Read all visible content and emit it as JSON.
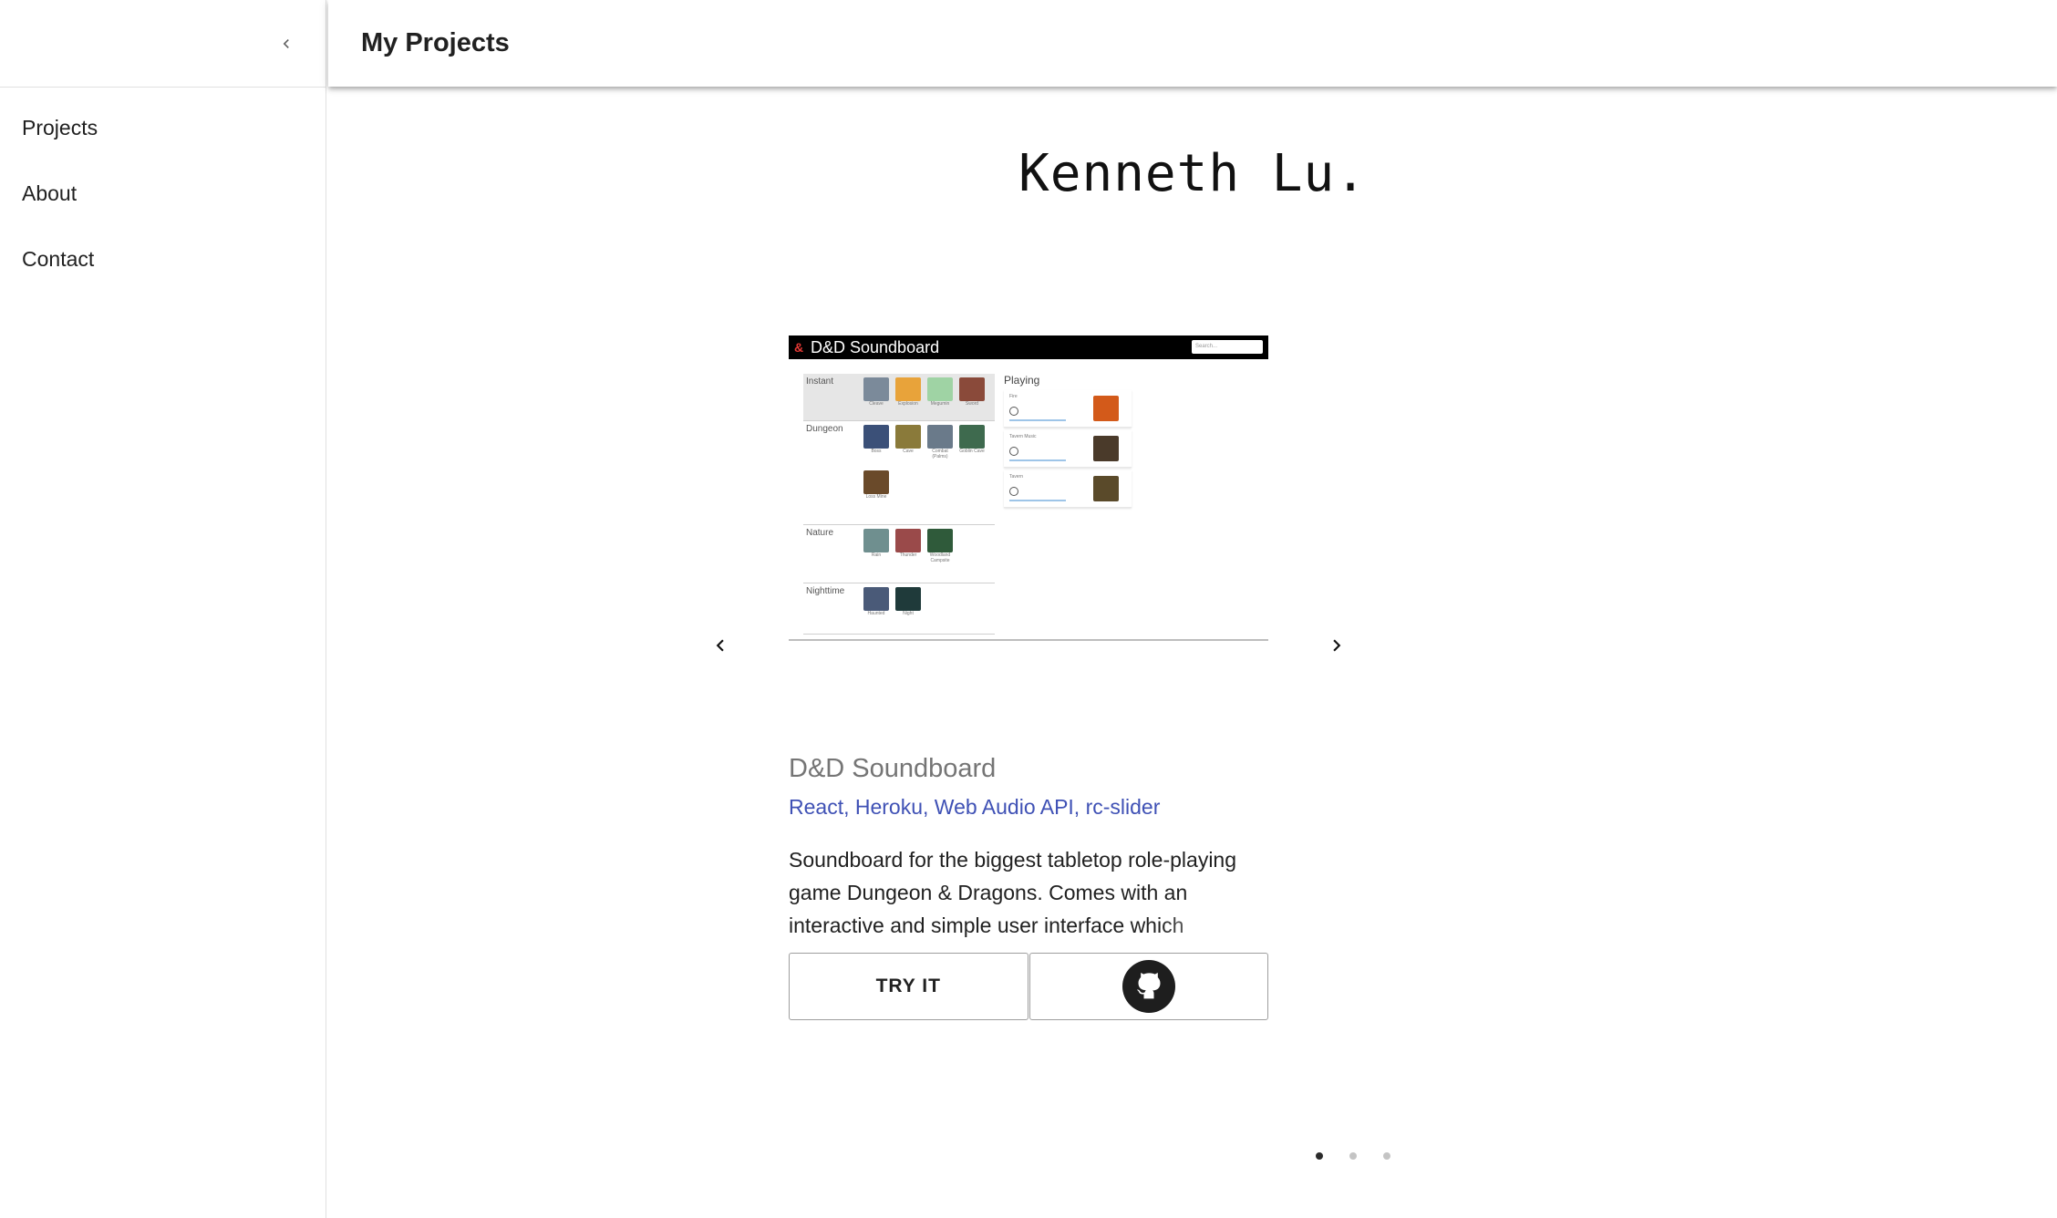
{
  "sidebar": {
    "items": [
      {
        "label": "Projects"
      },
      {
        "label": "About"
      },
      {
        "label": "Contact"
      }
    ]
  },
  "appbar": {
    "title": "My Projects"
  },
  "hero": {
    "name": "Kenneth Lu."
  },
  "carousel": {
    "current_index": 0,
    "dot_count": 3
  },
  "project": {
    "screenshot": {
      "title": "D&D Soundboard",
      "search_placeholder": "Search...",
      "sections": [
        {
          "label": "Instant",
          "tiles": [
            "Cleave",
            "Explosion",
            "Megumin",
            "Sword"
          ]
        },
        {
          "label": "Dungeon",
          "tiles": [
            "Boss",
            "Cave",
            "Combat (Palms)",
            "Goblin Cave",
            "Loss Mine"
          ]
        },
        {
          "label": "Nature",
          "tiles": [
            "Rain",
            "Thunder",
            "Woodland Campsite"
          ]
        },
        {
          "label": "Nighttime",
          "tiles": [
            "Haunted",
            "Night"
          ]
        }
      ],
      "playing_label": "Playing",
      "playing": [
        {
          "label": "Fire"
        },
        {
          "label": "Tavern Music"
        },
        {
          "label": "Tavern"
        }
      ]
    },
    "name": "D&D Soundboard",
    "tech": "React, Heroku, Web Audio API, rc-slider",
    "description": "Soundboard for the biggest tabletop role-playing game Dungeon & Dragons. Comes with an interactive and simple user interface which",
    "try_label": "TRY IT"
  },
  "colors": {
    "accent": "#3f51b5",
    "title_grey": "#757575",
    "text": "#212121"
  },
  "icons": {
    "collapse": "chevron-left-icon",
    "prev": "chevron-left-icon",
    "next": "chevron-right-icon",
    "repo": "github-icon"
  }
}
